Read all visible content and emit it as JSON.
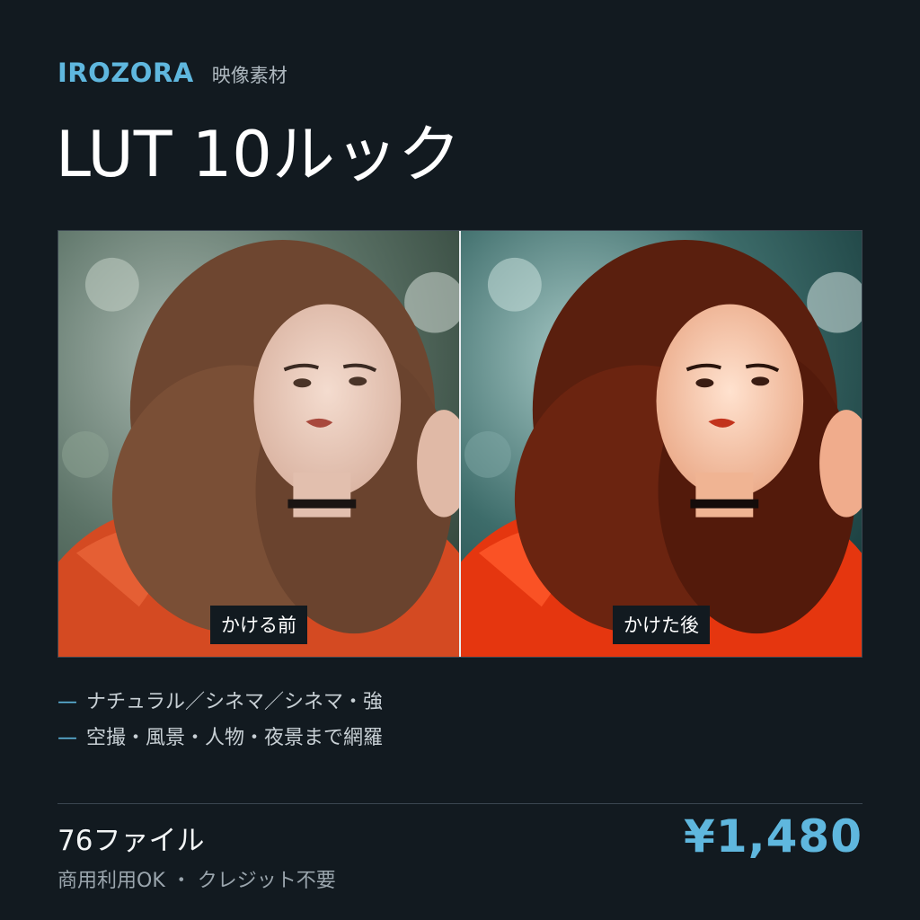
{
  "header": {
    "brand": "IROZORA",
    "category": "映像素材"
  },
  "title": "LUT 10ルック",
  "comparison": {
    "before_label": "かける前",
    "after_label": "かけた後"
  },
  "features": [
    {
      "dash": "—",
      "text": "ナチュラル／シネマ／シネマ・強"
    },
    {
      "dash": "—",
      "text": "空撮・風景・人物・夜景まで網羅"
    }
  ],
  "footer": {
    "file_count": "76ファイル",
    "license": "商用利用OK ・ クレジット不要",
    "price": "¥1,480"
  },
  "colors": {
    "background": "#121a20",
    "accent": "#5fb7de",
    "text": "#f3f5f6",
    "muted": "#9aa5ad"
  }
}
